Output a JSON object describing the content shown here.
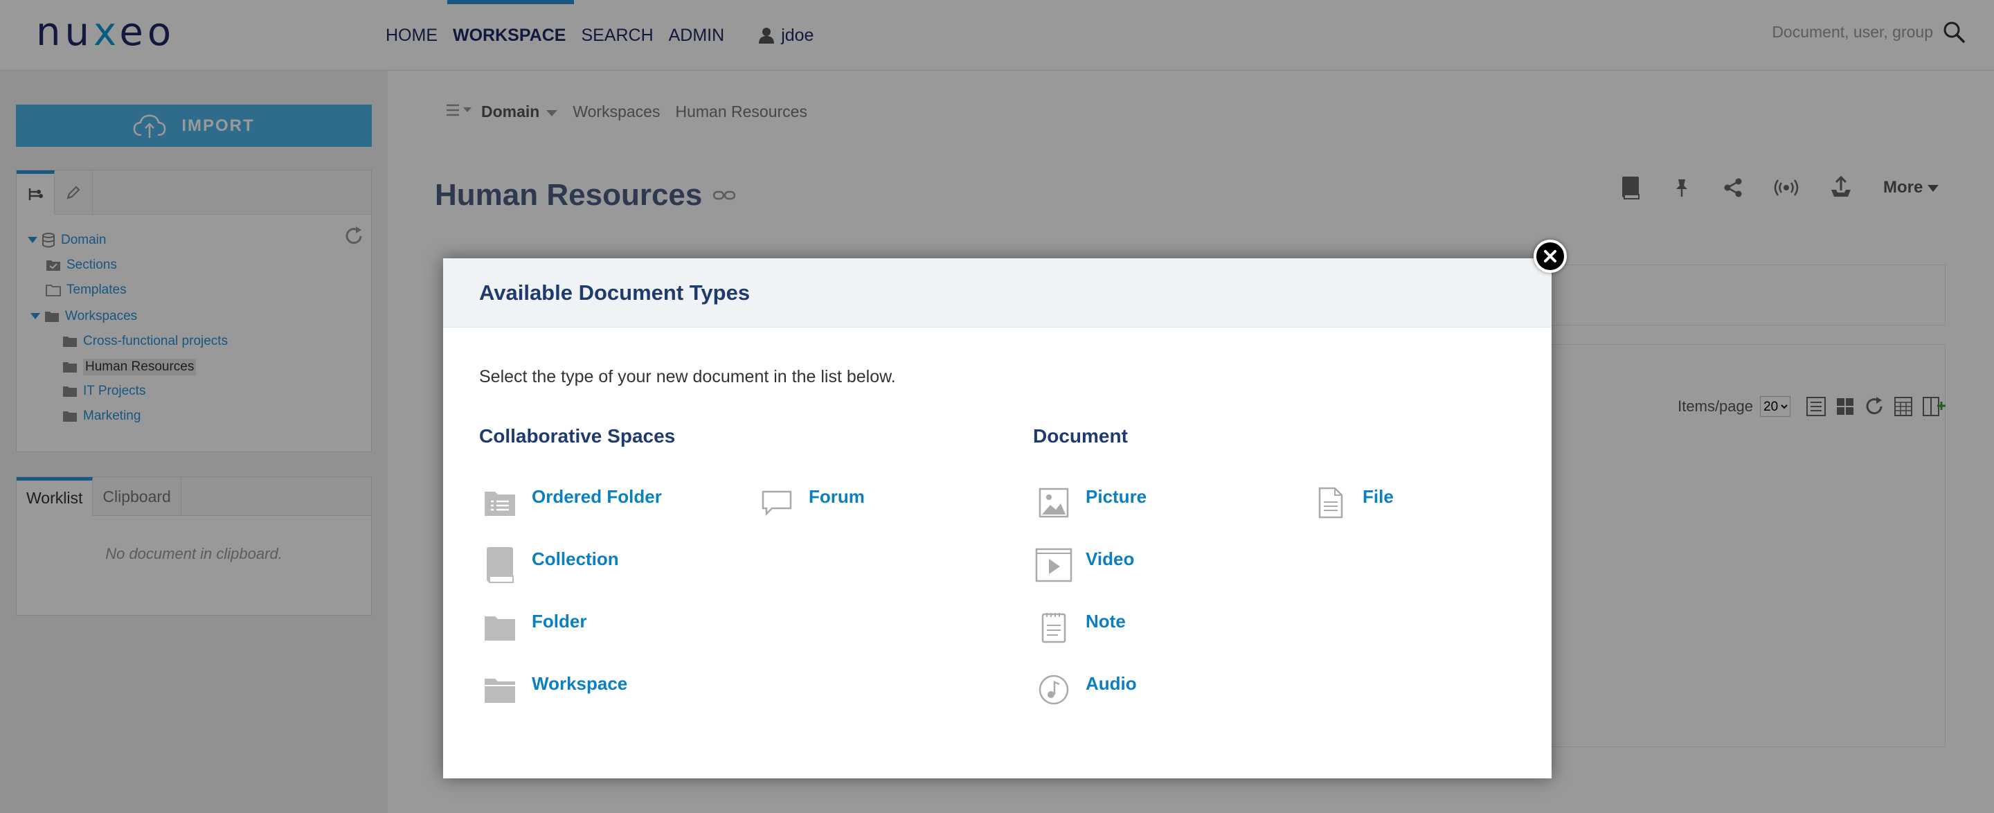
{
  "header": {
    "logo": "nuxeo",
    "nav": [
      {
        "label": "HOME",
        "active": false
      },
      {
        "label": "WORKSPACE",
        "active": true
      },
      {
        "label": "SEARCH",
        "active": false
      },
      {
        "label": "ADMIN",
        "active": false
      }
    ],
    "user": "jdoe",
    "search_placeholder": "Document, user, group"
  },
  "sidebar": {
    "import_label": "IMPORT",
    "tree": [
      {
        "label": "Domain",
        "level": 0
      },
      {
        "label": "Sections",
        "level": 1
      },
      {
        "label": "Templates",
        "level": 1
      },
      {
        "label": "Workspaces",
        "level": 1
      },
      {
        "label": "Cross-functional projects",
        "level": 2
      },
      {
        "label": "Human Resources",
        "level": 2,
        "selected": true
      },
      {
        "label": "IT Projects",
        "level": 2
      },
      {
        "label": "Marketing",
        "level": 2
      }
    ],
    "worklist_tabs": [
      "Worklist",
      "Clipboard"
    ],
    "empty_message": "No document in clipboard."
  },
  "main": {
    "breadcrumb": {
      "domain": "Domain",
      "crumbs": [
        "Workspaces",
        "Human Resources"
      ]
    },
    "title": "Human Resources",
    "more_label": "More",
    "items_per_page_label": "Items/page",
    "items_per_page_value": "20"
  },
  "modal": {
    "title": "Available Document Types",
    "description": "Select the type of your new document in the list below.",
    "categories": [
      {
        "name": "Collaborative Spaces",
        "types": [
          "Ordered Folder",
          "Forum",
          "Collection",
          "Folder",
          "Workspace"
        ]
      },
      {
        "name": "Document",
        "types": [
          "Picture",
          "File",
          "Video",
          "Note",
          "Audio"
        ]
      }
    ]
  },
  "colors": {
    "brand": "#1f2a64",
    "accent": "#2b8fd6",
    "link": "#0a7fc1",
    "import_button": "#4fb5ea"
  }
}
